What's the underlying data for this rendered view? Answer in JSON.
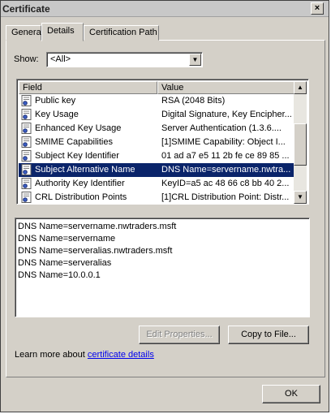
{
  "window": {
    "title": "Certificate",
    "close_glyph": "×"
  },
  "tabs": [
    {
      "label": "General",
      "active": false
    },
    {
      "label": "Details",
      "active": true
    },
    {
      "label": "Certification Path",
      "active": false
    }
  ],
  "show": {
    "label": "Show:",
    "selected": "<All>"
  },
  "fields_list": {
    "columns": [
      "Field",
      "Value"
    ],
    "rows": [
      {
        "field": "Public key",
        "value": "RSA (2048 Bits)",
        "icon": "certificate-field-icon",
        "selected": false
      },
      {
        "field": "Key Usage",
        "value": "Digital Signature, Key Encipher...",
        "icon": "certificate-extension-icon",
        "selected": false
      },
      {
        "field": "Enhanced Key Usage",
        "value": "Server Authentication (1.3.6....",
        "icon": "certificate-extension-icon",
        "selected": false
      },
      {
        "field": "SMIME Capabilities",
        "value": "[1]SMIME Capability: Object I...",
        "icon": "certificate-extension-icon",
        "selected": false
      },
      {
        "field": "Subject Key Identifier",
        "value": "01 ad a7 e5 11 2b fe ce 89 85 ...",
        "icon": "certificate-extension-icon",
        "selected": false
      },
      {
        "field": "Subject Alternative Name",
        "value": "DNS Name=servername.nwtra...",
        "icon": "certificate-extension-icon",
        "selected": true
      },
      {
        "field": "Authority Key Identifier",
        "value": "KeyID=a5 ac 48 66 c8 bb 40 2...",
        "icon": "certificate-extension-icon",
        "selected": false
      },
      {
        "field": "CRL Distribution Points",
        "value": "[1]CRL Distribution Point: Distr...",
        "icon": "certificate-extension-icon",
        "selected": false
      }
    ]
  },
  "details_text": [
    "DNS Name=servername.nwtraders.msft",
    "DNS Name=servername",
    "DNS Name=serveralias.nwtraders.msft",
    "DNS Name=serveralias",
    "DNS Name=10.0.0.1"
  ],
  "buttons": {
    "edit_properties": "Edit Properties...",
    "copy_to_file": "Copy to File...",
    "ok": "OK"
  },
  "learn_more": {
    "prefix": "Learn more about ",
    "link": "certificate details"
  },
  "colors": {
    "selection": "#0a246a",
    "dialog_bg": "#d4d0c8",
    "link": "#0000ee"
  }
}
